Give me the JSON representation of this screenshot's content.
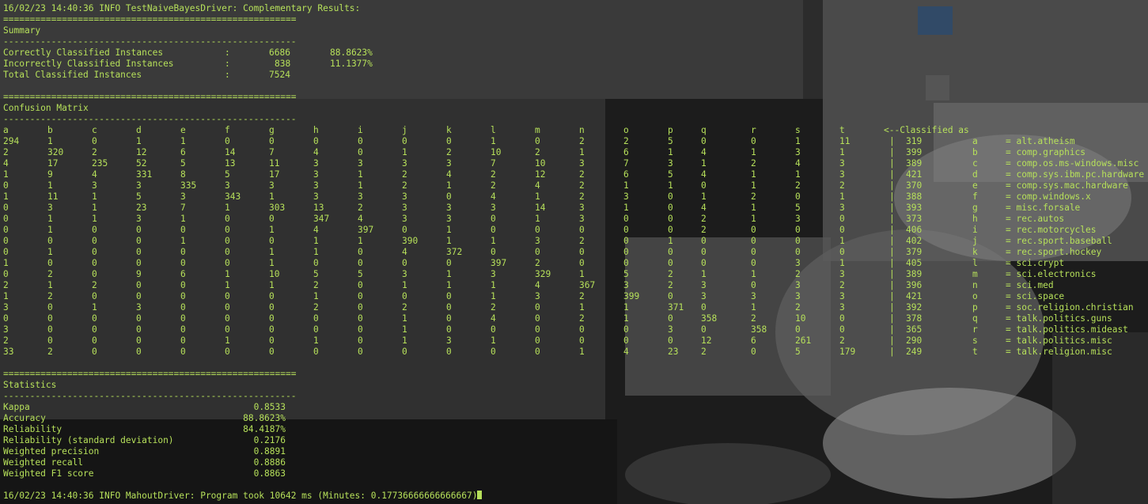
{
  "colors": {
    "text": "#b6e05a",
    "background": "#1a1a1a"
  },
  "header_line": "16/02/23 14:40:36 INFO TestNaiveBayesDriver: Complementary Results:",
  "separator_double": "=======================================================",
  "separator_single": "-------------------------------------------------------",
  "summary": {
    "title": "Summary",
    "rows": [
      {
        "label": "Correctly Classified Instances",
        "colon": ":",
        "count": "6686",
        "percent": "88.8623%"
      },
      {
        "label": "Incorrectly Classified Instances",
        "colon": ":",
        "count": "838",
        "percent": "11.1377%"
      },
      {
        "label": "Total Classified Instances",
        "colon": ":",
        "count": "7524",
        "percent": ""
      }
    ]
  },
  "confusion": {
    "title": "Confusion Matrix",
    "headers": [
      "a",
      "b",
      "c",
      "d",
      "e",
      "f",
      "g",
      "h",
      "i",
      "j",
      "k",
      "l",
      "m",
      "n",
      "o",
      "p",
      "q",
      "r",
      "s",
      "t"
    ],
    "classified_as": "<--Classified as",
    "rows": [
      {
        "values": [
          "294",
          "1",
          "0",
          "1",
          "1",
          "0",
          "0",
          "0",
          "0",
          "0",
          "0",
          "1",
          "0",
          "2",
          "2",
          "5",
          "0",
          "0",
          "1",
          "11"
        ],
        "total": "319",
        "letter": "a",
        "name": "= alt.atheism"
      },
      {
        "values": [
          "2",
          "320",
          "2",
          "12",
          "6",
          "14",
          "7",
          "4",
          "0",
          "1",
          "2",
          "10",
          "2",
          "1",
          "6",
          "1",
          "4",
          "1",
          "3",
          "1"
        ],
        "total": "399",
        "letter": "b",
        "name": "= comp.graphics"
      },
      {
        "values": [
          "4",
          "17",
          "235",
          "52",
          "5",
          "13",
          "11",
          "3",
          "3",
          "3",
          "3",
          "7",
          "10",
          "3",
          "7",
          "3",
          "1",
          "2",
          "4",
          "3"
        ],
        "total": "389",
        "letter": "c",
        "name": "= comp.os.ms-windows.misc"
      },
      {
        "values": [
          "1",
          "9",
          "4",
          "331",
          "8",
          "5",
          "17",
          "3",
          "1",
          "2",
          "4",
          "2",
          "12",
          "2",
          "6",
          "5",
          "4",
          "1",
          "1",
          "3"
        ],
        "total": "421",
        "letter": "d",
        "name": "= comp.sys.ibm.pc.hardware"
      },
      {
        "values": [
          "0",
          "1",
          "3",
          "3",
          "335",
          "3",
          "3",
          "3",
          "1",
          "2",
          "1",
          "2",
          "4",
          "2",
          "1",
          "1",
          "0",
          "1",
          "2",
          "2"
        ],
        "total": "370",
        "letter": "e",
        "name": "= comp.sys.mac.hardware"
      },
      {
        "values": [
          "1",
          "11",
          "1",
          "5",
          "3",
          "343",
          "1",
          "3",
          "3",
          "3",
          "0",
          "4",
          "1",
          "2",
          "3",
          "0",
          "1",
          "2",
          "0",
          "1"
        ],
        "total": "388",
        "letter": "f",
        "name": "= comp.windows.x"
      },
      {
        "values": [
          "0",
          "3",
          "1",
          "23",
          "7",
          "1",
          "303",
          "13",
          "2",
          "3",
          "3",
          "3",
          "14",
          "3",
          "1",
          "0",
          "4",
          "1",
          "5",
          "3"
        ],
        "total": "393",
        "letter": "g",
        "name": "= misc.forsale"
      },
      {
        "values": [
          "0",
          "1",
          "1",
          "3",
          "1",
          "0",
          "0",
          "347",
          "4",
          "3",
          "3",
          "0",
          "1",
          "3",
          "0",
          "0",
          "2",
          "1",
          "3",
          "0"
        ],
        "total": "373",
        "letter": "h",
        "name": "= rec.autos"
      },
      {
        "values": [
          "0",
          "1",
          "0",
          "0",
          "0",
          "0",
          "1",
          "4",
          "397",
          "0",
          "1",
          "0",
          "0",
          "0",
          "0",
          "0",
          "2",
          "0",
          "0",
          "0"
        ],
        "total": "406",
        "letter": "i",
        "name": "= rec.motorcycles"
      },
      {
        "values": [
          "0",
          "0",
          "0",
          "0",
          "1",
          "0",
          "0",
          "1",
          "1",
          "390",
          "1",
          "1",
          "3",
          "2",
          "0",
          "1",
          "0",
          "0",
          "0",
          "1"
        ],
        "total": "402",
        "letter": "j",
        "name": "= rec.sport.baseball"
      },
      {
        "values": [
          "0",
          "1",
          "0",
          "0",
          "0",
          "0",
          "1",
          "1",
          "0",
          "4",
          "372",
          "0",
          "0",
          "0",
          "0",
          "0",
          "0",
          "0",
          "0",
          "0"
        ],
        "total": "379",
        "letter": "k",
        "name": "= rec.sport.hockey"
      },
      {
        "values": [
          "1",
          "0",
          "0",
          "0",
          "0",
          "0",
          "1",
          "0",
          "0",
          "0",
          "0",
          "397",
          "2",
          "0",
          "0",
          "0",
          "0",
          "0",
          "3",
          "1"
        ],
        "total": "405",
        "letter": "l",
        "name": "= sci.crypt"
      },
      {
        "values": [
          "0",
          "2",
          "0",
          "9",
          "6",
          "1",
          "10",
          "5",
          "5",
          "3",
          "1",
          "3",
          "329",
          "1",
          "5",
          "2",
          "1",
          "1",
          "2",
          "3"
        ],
        "total": "389",
        "letter": "m",
        "name": "= sci.electronics"
      },
      {
        "values": [
          "2",
          "1",
          "2",
          "0",
          "0",
          "1",
          "1",
          "2",
          "0",
          "1",
          "1",
          "1",
          "4",
          "367",
          "3",
          "2",
          "3",
          "0",
          "3",
          "2"
        ],
        "total": "396",
        "letter": "n",
        "name": "= sci.med"
      },
      {
        "values": [
          "1",
          "2",
          "0",
          "0",
          "0",
          "0",
          "0",
          "1",
          "0",
          "0",
          "0",
          "1",
          "3",
          "2",
          "399",
          "0",
          "3",
          "3",
          "3",
          "3"
        ],
        "total": "421",
        "letter": "o",
        "name": "= sci.space"
      },
      {
        "values": [
          "3",
          "0",
          "1",
          "3",
          "0",
          "0",
          "0",
          "2",
          "0",
          "2",
          "0",
          "2",
          "0",
          "1",
          "1",
          "371",
          "0",
          "1",
          "2",
          "3"
        ],
        "total": "392",
        "letter": "p",
        "name": "= soc.religion.christian"
      },
      {
        "values": [
          "0",
          "0",
          "0",
          "0",
          "0",
          "0",
          "0",
          "0",
          "0",
          "1",
          "0",
          "4",
          "0",
          "2",
          "1",
          "0",
          "358",
          "2",
          "10",
          "0"
        ],
        "total": "378",
        "letter": "q",
        "name": "= talk.politics.guns"
      },
      {
        "values": [
          "3",
          "0",
          "0",
          "0",
          "0",
          "0",
          "0",
          "0",
          "0",
          "1",
          "0",
          "0",
          "0",
          "0",
          "0",
          "3",
          "0",
          "358",
          "0",
          "0"
        ],
        "total": "365",
        "letter": "r",
        "name": "= talk.politics.mideast"
      },
      {
        "values": [
          "2",
          "0",
          "0",
          "0",
          "0",
          "1",
          "0",
          "1",
          "0",
          "1",
          "3",
          "1",
          "0",
          "0",
          "0",
          "0",
          "12",
          "6",
          "261",
          "2"
        ],
        "total": "290",
        "letter": "s",
        "name": "= talk.politics.misc"
      },
      {
        "values": [
          "33",
          "2",
          "0",
          "0",
          "0",
          "0",
          "0",
          "0",
          "0",
          "0",
          "0",
          "0",
          "0",
          "1",
          "4",
          "23",
          "2",
          "0",
          "5",
          "179"
        ],
        "total": "249",
        "letter": "t",
        "name": "= talk.religion.misc"
      }
    ]
  },
  "statistics": {
    "title": "Statistics",
    "rows": [
      {
        "label": "Kappa",
        "value": "0.8533"
      },
      {
        "label": "Accuracy",
        "value": "88.8623%"
      },
      {
        "label": "Reliability",
        "value": "84.4187%"
      },
      {
        "label": "Reliability (standard deviation)",
        "value": "0.2176"
      },
      {
        "label": "Weighted precision",
        "value": "0.8891"
      },
      {
        "label": "Weighted recall",
        "value": "0.8886"
      },
      {
        "label": "Weighted F1 score",
        "value": "0.8863"
      }
    ]
  },
  "footer_line": "16/02/23 14:40:36 INFO MahoutDriver: Program took 10642 ms (Minutes: 0.17736666666666667)"
}
